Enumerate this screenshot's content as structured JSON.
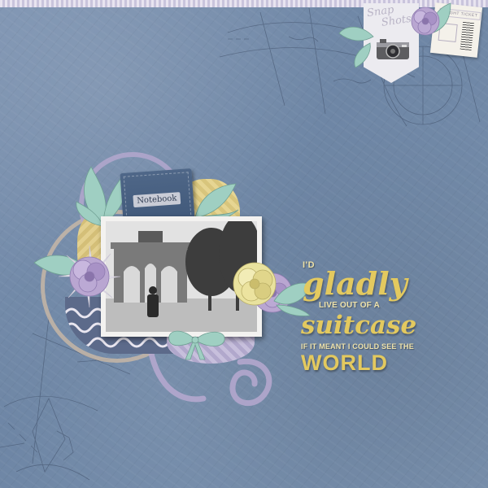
{
  "tag": {
    "line1": "Snap",
    "line2": "Shots"
  },
  "ticket": {
    "label": "FLIGHT TICKET"
  },
  "notebook": {
    "label": "Notebook"
  },
  "title": {
    "line1": "I'D",
    "line2": "gladly",
    "line3": "LIVE OUT OF A",
    "line4": "suitcase",
    "line5": "IF IT MEANT I COULD SEE THE",
    "line6": "WORLD"
  },
  "colors": {
    "background": "#7289a8",
    "title_gold": "#e3c95f",
    "lavender": "#b7a9d0",
    "mint": "#9fcfc2"
  },
  "icons": [
    "camera-icon",
    "flower-icon",
    "leaf-icon",
    "compass-rose-icon"
  ]
}
